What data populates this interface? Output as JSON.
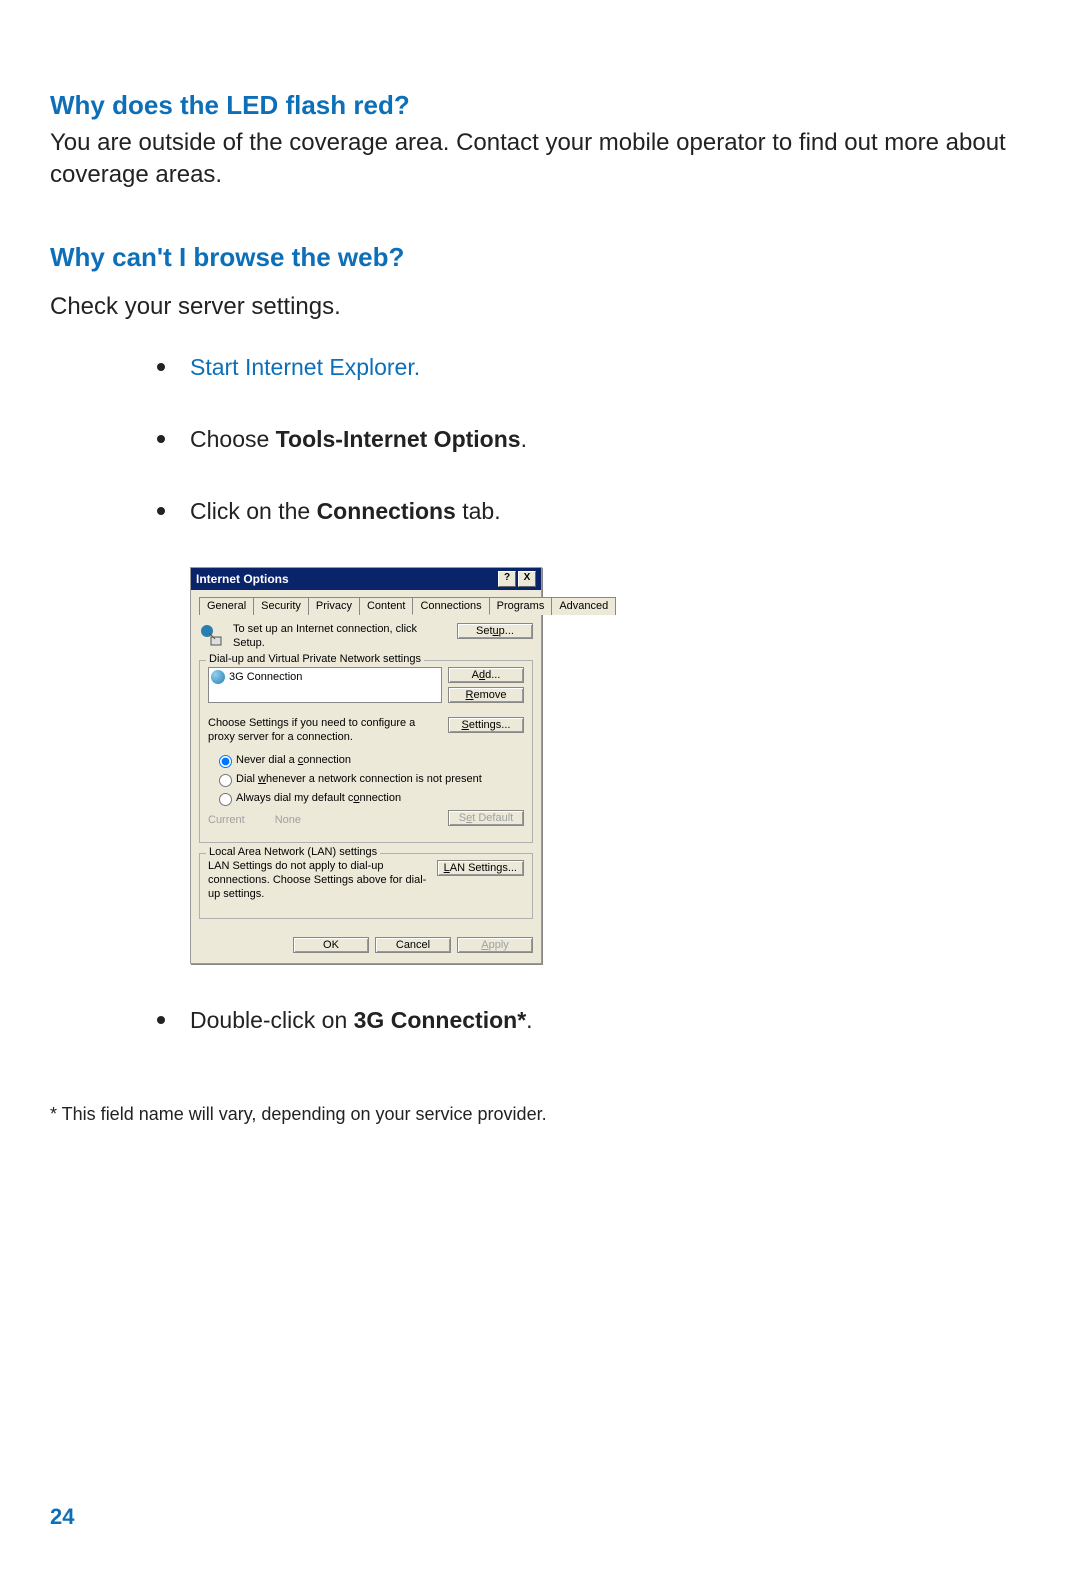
{
  "section1": {
    "heading": "Why does the LED flash red?",
    "body": "You are outside of the coverage area. Contact your mobile operator to find out more about coverage areas."
  },
  "section2": {
    "heading": "Why can't I browse the web?",
    "intro": "Check your server settings.",
    "step1": "Start Internet Explorer.",
    "step2_pre": "Choose ",
    "step2_bold": "Tools-Internet Options",
    "step2_post": ".",
    "step3_pre": "Click on the ",
    "step3_bold": "Connections",
    "step3_post": " tab.",
    "step4_pre": "Double-click on ",
    "step4_bold": "3G Connection*",
    "step4_post": "."
  },
  "dlg": {
    "title": "Internet Options",
    "help": "?",
    "close": "X",
    "tabs": {
      "general": "General",
      "security": "Security",
      "privacy": "Privacy",
      "content": "Content",
      "connections": "Connections",
      "programs": "Programs",
      "advanced": "Advanced"
    },
    "setup_text": "To set up an Internet connection, click Setup.",
    "setup_btn": "Setup...",
    "fs1_legend": "Dial-up and Virtual Private Network settings",
    "conn_item": "3G Connection",
    "add_btn": "Add...",
    "remove_btn": "Remove",
    "settings_text": "Choose Settings if you need to configure a proxy server for a connection.",
    "settings_btn": "Settings...",
    "r1": "Never dial a connection",
    "r2": "Dial whenever a network connection is not present",
    "r3": "Always dial my default connection",
    "current_lbl": "Current",
    "current_val": "None",
    "setdef_btn": "Set Default",
    "fs2_legend": "Local Area Network (LAN) settings",
    "lan_text": "LAN Settings do not apply to dial-up connections. Choose Settings above for dial-up settings.",
    "lan_btn": "LAN Settings...",
    "ok": "OK",
    "cancel": "Cancel",
    "apply": "Apply"
  },
  "footnote": "* This field name will vary, depending on your service provider.",
  "page_number": "24"
}
